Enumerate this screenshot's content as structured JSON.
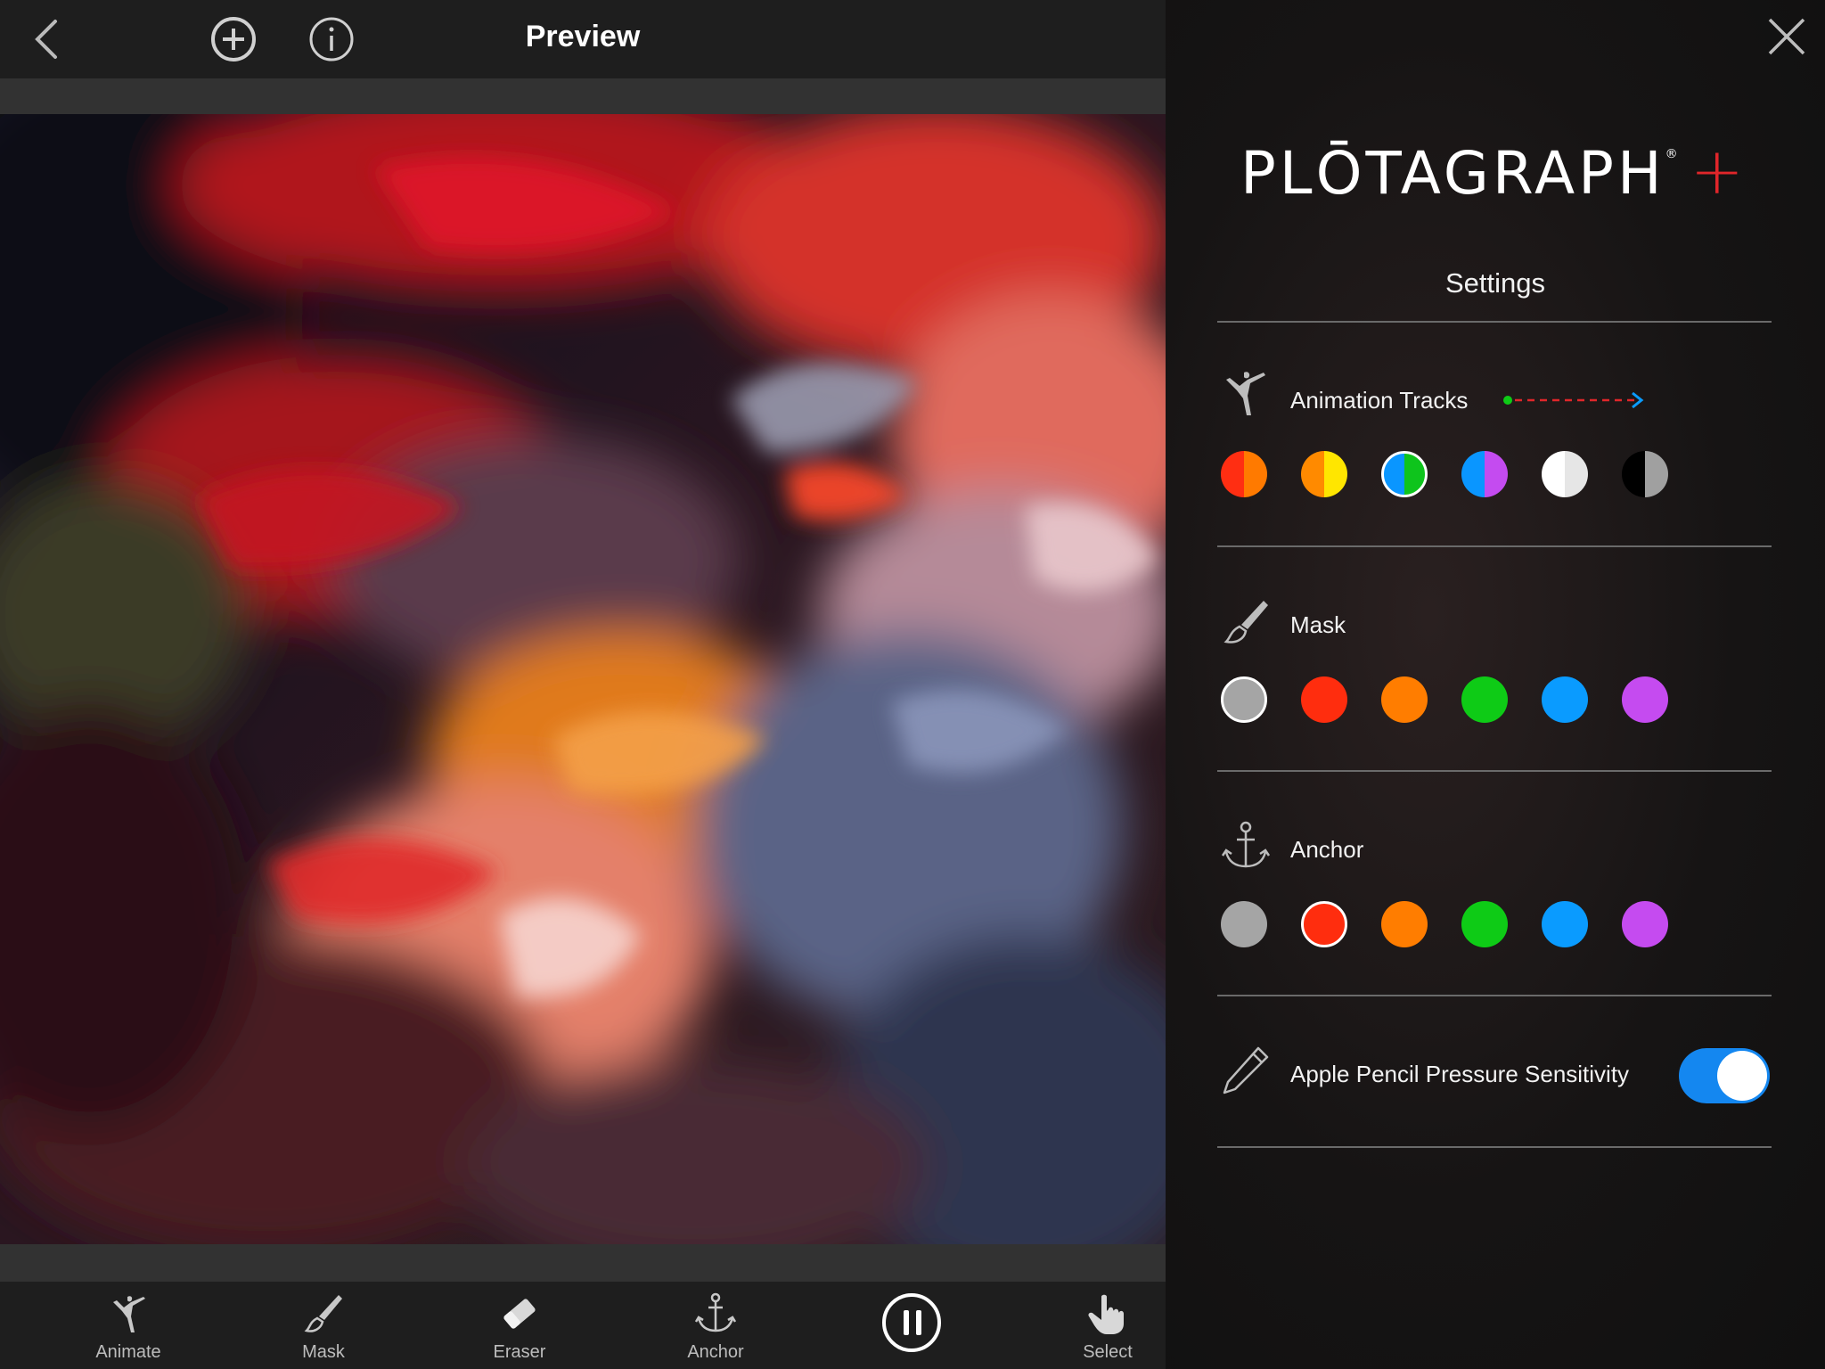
{
  "topbar": {
    "title": "Preview"
  },
  "toolbar": {
    "tools": [
      {
        "label": "Animate"
      },
      {
        "label": "Mask"
      },
      {
        "label": "Eraser"
      },
      {
        "label": "Anchor"
      },
      {
        "label": "Select"
      }
    ],
    "play_state": "paused"
  },
  "panel": {
    "logo": {
      "text": "PLŌTAGRAPH",
      "registered": "®",
      "plus": "+"
    },
    "settings_title": "Settings",
    "animation_tracks": {
      "label": "Animation Tracks",
      "swatches": [
        {
          "left": "#ff2e12",
          "right": "#ff7a00",
          "selected": false
        },
        {
          "left": "#ff8a00",
          "right": "#ffe600",
          "selected": false
        },
        {
          "left": "#0a96ff",
          "right": "#0ec41c",
          "selected": true
        },
        {
          "left": "#0a96ff",
          "right": "#c44bf0",
          "selected": false
        },
        {
          "left": "#ffffff",
          "right": "#e6e6e6",
          "selected": false
        },
        {
          "left": "#000000",
          "right": "#a0a0a0",
          "selected": false
        }
      ]
    },
    "mask": {
      "label": "Mask",
      "swatches": [
        {
          "color": "#a5a5a5",
          "selected": true
        },
        {
          "color": "#ff2d0e",
          "selected": false
        },
        {
          "color": "#ff7d00",
          "selected": false
        },
        {
          "color": "#0ecb16",
          "selected": false
        },
        {
          "color": "#0a9bff",
          "selected": false
        },
        {
          "color": "#c54bf0",
          "selected": false
        }
      ]
    },
    "anchor": {
      "label": "Anchor",
      "swatches": [
        {
          "color": "#a5a5a5",
          "selected": false
        },
        {
          "color": "#ff2d0e",
          "selected": true
        },
        {
          "color": "#ff7d00",
          "selected": false
        },
        {
          "color": "#0ecb16",
          "selected": false
        },
        {
          "color": "#0a9bff",
          "selected": false
        },
        {
          "color": "#c54bf0",
          "selected": false
        }
      ]
    },
    "pencil": {
      "label": "Apple Pencil Pressure Sensitivity",
      "enabled": true
    }
  },
  "colors": {
    "accent_blue": "#1487f0",
    "brand_red": "#e0262a",
    "track_start": "#0ecb16",
    "track_line": "#e0262a",
    "track_end": "#0a9bff"
  }
}
